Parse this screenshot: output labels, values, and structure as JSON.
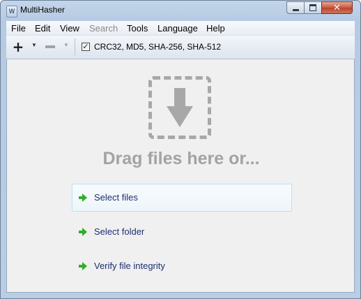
{
  "window": {
    "title": "MultiHasher",
    "icon_letter": "W",
    "controls": {
      "minimize": "minimize-icon",
      "maximize": "maximize-icon",
      "close": "✕"
    }
  },
  "menubar": {
    "items": [
      {
        "label": "File",
        "enabled": true
      },
      {
        "label": "Edit",
        "enabled": true
      },
      {
        "label": "View",
        "enabled": true
      },
      {
        "label": "Search",
        "enabled": false
      },
      {
        "label": "Tools",
        "enabled": true
      },
      {
        "label": "Language",
        "enabled": true
      },
      {
        "label": "Help",
        "enabled": true
      }
    ]
  },
  "toolbar": {
    "add_glyph": "+",
    "dropdown_glyph": "▼",
    "algorithms_checked": true,
    "check_glyph": "✓",
    "algorithms_label": "CRC32, MD5, SHA-256, SHA-512"
  },
  "main": {
    "drop_prompt": "Drag files here or...",
    "actions": [
      {
        "label": "Select files",
        "highlighted": true
      },
      {
        "label": "Select folder",
        "highlighted": false
      },
      {
        "label": "Verify file integrity",
        "highlighted": false
      }
    ]
  },
  "colors": {
    "accent_arrow": "#2fae2a",
    "drop_gray": "#a8a8a8",
    "action_text": "#1e2e6e",
    "disabled_text": "#8a8a8a"
  }
}
